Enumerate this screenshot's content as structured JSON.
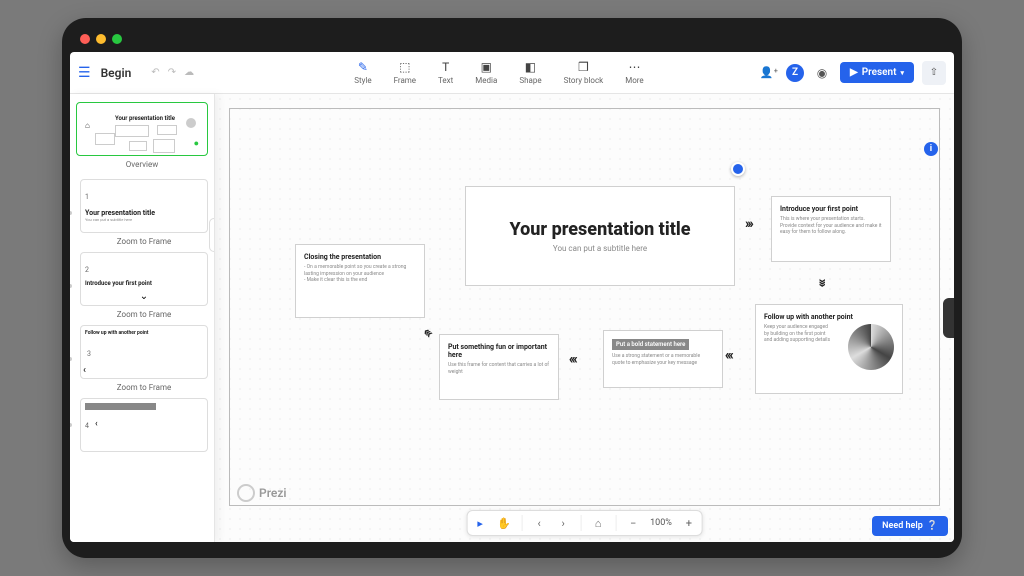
{
  "header": {
    "title": "Begin",
    "present_label": "Present"
  },
  "toolbar": {
    "items": [
      {
        "icon": "pen",
        "label": "Style"
      },
      {
        "icon": "frame",
        "label": "Frame"
      },
      {
        "icon": "text",
        "label": "Text"
      },
      {
        "icon": "media",
        "label": "Media"
      },
      {
        "icon": "shape",
        "label": "Shape"
      },
      {
        "icon": "story",
        "label": "Story block"
      },
      {
        "icon": "more",
        "label": "More"
      }
    ]
  },
  "avatar_letter": "Z",
  "sidebar": {
    "overview_label": "Overview",
    "zoom_label": "Zoom to Frame",
    "thumbs": [
      {
        "n": "1",
        "title": "Your presentation title"
      },
      {
        "n": "2",
        "title": "Introduce your first point"
      },
      {
        "n": "3",
        "title": "Follow up with another point"
      },
      {
        "n": "4",
        "title": "Put a bold statement here"
      }
    ]
  },
  "canvas": {
    "main_title": "Your presentation title",
    "main_sub": "You can put a subtitle here",
    "intro_title": "Introduce your first point",
    "intro_body": "This is where your presentation starts. Provide context for your audience and make it easy for them to follow along.",
    "closing_title": "Closing the presentation",
    "closing_body": "- On a memorable point so you create a strong lasting impression on your audience\n- Make it clear this is the end",
    "fun_title": "Put something fun or important here",
    "fun_body": "Use this frame for content that carries a lot of weight",
    "bold_hl": "Put a bold statement here",
    "follow_title": "Follow up with another point",
    "follow_body": "Keep your audience engaged by building on the first point and adding supporting details"
  },
  "zoom_level": "100%",
  "brand": "Prezi",
  "need_help": "Need help"
}
